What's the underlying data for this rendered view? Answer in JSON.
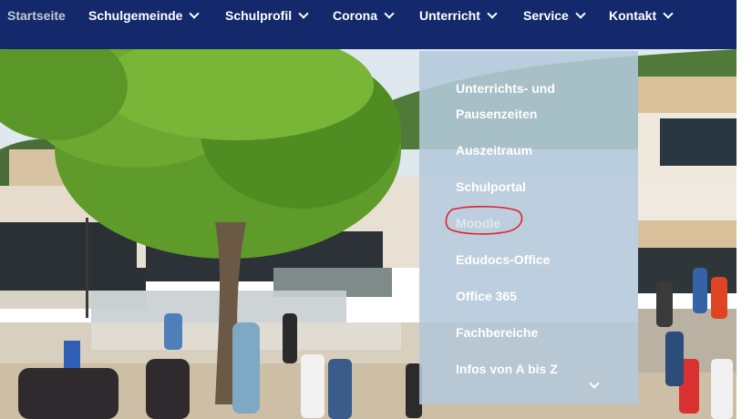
{
  "nav": {
    "items": [
      {
        "label": "Startseite"
      },
      {
        "label": "Schulgemeinde"
      },
      {
        "label": "Schulprofil"
      },
      {
        "label": "Corona"
      },
      {
        "label": "Unterricht"
      },
      {
        "label": "Service"
      },
      {
        "label": "Kontakt"
      }
    ]
  },
  "dropdown": {
    "items": [
      {
        "label_line1": "Unterrichts- und",
        "label_line2": "Pausenzeiten"
      },
      {
        "label": "Auszeitraum"
      },
      {
        "label": "Schulportal"
      },
      {
        "label": "Moodle"
      },
      {
        "label": "Edudocs-Office"
      },
      {
        "label": "Office 365"
      },
      {
        "label": "Fachbereiche"
      },
      {
        "label": "Infos von A bis Z"
      }
    ]
  },
  "colors": {
    "navbar": "#13296b",
    "dropdown": "#b4c8da",
    "annotation": "#e0202a"
  },
  "icons": [
    "chevron-down-icon"
  ]
}
